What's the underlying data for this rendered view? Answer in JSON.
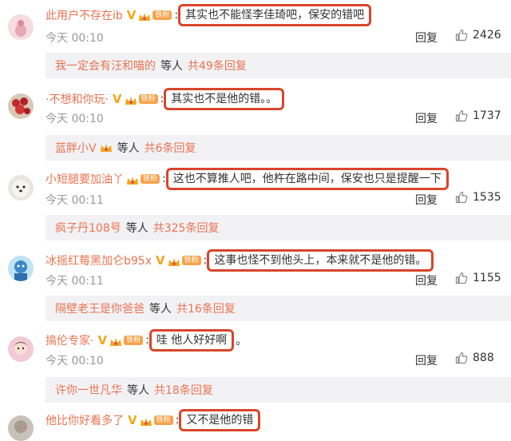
{
  "comments": [
    {
      "username": "此用户不存在ib",
      "has_v": true,
      "fan_label": "铁粉",
      "text": "其实也不能怪李佳琦吧，保安的错吧",
      "trail": "",
      "time": "今天 00:10",
      "reply_label": "回复",
      "likes": "2426",
      "sub": {
        "who": "我一定会有汪和喵的",
        "mid": "等人",
        "count": "共49条回复",
        "crown": false
      }
    },
    {
      "username": "·不想和你玩·",
      "has_v": true,
      "fan_label": "铁粉",
      "text": "其实也不是他的错。。",
      "trail": "",
      "time": "今天 00:10",
      "reply_label": "回复",
      "likes": "1737",
      "sub": {
        "who": "蓝胖小V",
        "mid": "等人",
        "count": "共6条回复",
        "crown": true
      }
    },
    {
      "username": "小短腿要加油丫",
      "has_v": false,
      "fan_label": "铁粉",
      "text": "这也不算推人吧，他杵在路中间，保安也只是提醒一下",
      "trail": "",
      "time": "今天 00:11",
      "reply_label": "回复",
      "likes": "1535",
      "sub": {
        "who": "疯子丹108号",
        "mid": "等人",
        "count": "共325条回复",
        "crown": false
      }
    },
    {
      "username": "冰摇红莓黑加仑b95x",
      "has_v": true,
      "fan_label": "铁粉",
      "text": "这事也怪不到他头上，本来就不是他的错。",
      "trail": "",
      "time": "今天 00:11",
      "reply_label": "回复",
      "likes": "1155",
      "sub": {
        "who": "隔壁老王是你爸爸",
        "mid": "等人",
        "count": "共16条回复",
        "crown": false
      }
    },
    {
      "username": "搞伦专家·",
      "has_v": true,
      "fan_label": "铁粉",
      "text": "哇 他人好好啊",
      "trail": "。",
      "time": "今天 00:10",
      "reply_label": "回复",
      "likes": "888",
      "sub": {
        "who": "许你一世凡华",
        "mid": "等人",
        "count": "共18条回复",
        "crown": false
      }
    },
    {
      "username": "他比你好看多了",
      "has_v": true,
      "fan_label": "铁粉",
      "text": "又不是他的错",
      "trail": ""
    }
  ],
  "colors": {
    "accent": "#eb7350",
    "highlight_border": "#d9452b",
    "badge_v": "#f0a81b",
    "subbar": "#f2f2f5"
  },
  "icons": {
    "like": "thumbs-up-icon",
    "v": "verified-v-icon",
    "crown": "crown-icon"
  }
}
